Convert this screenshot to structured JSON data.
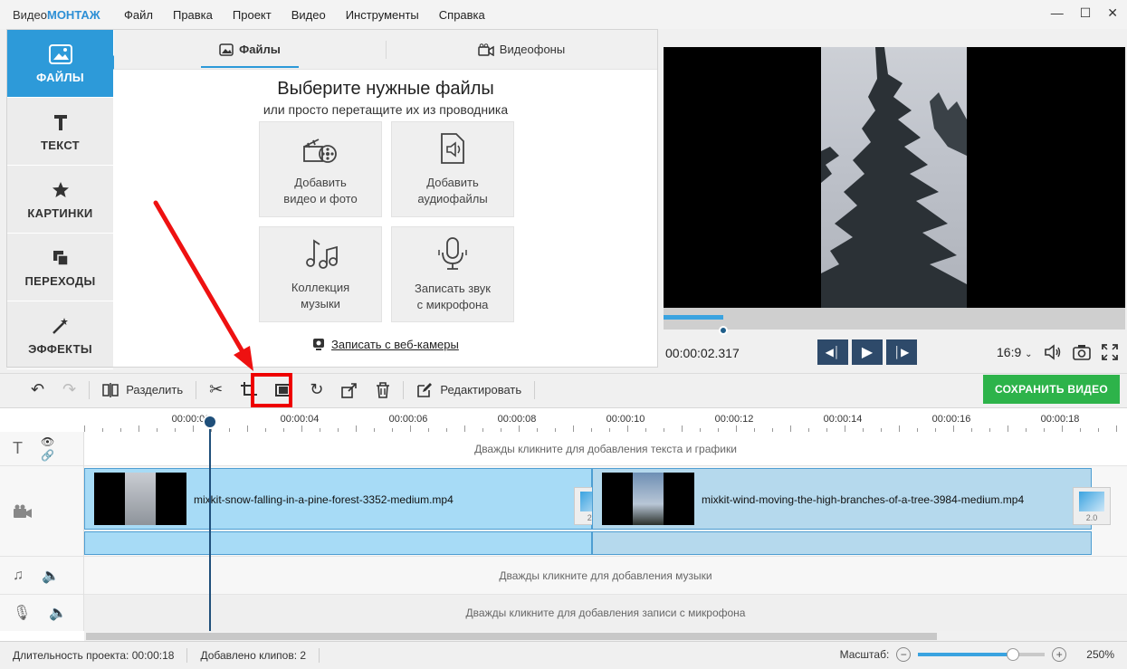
{
  "app": {
    "logo_prefix": "Видео",
    "logo_brand": "МОНТАЖ",
    "menu": [
      "Файл",
      "Правка",
      "Проект",
      "Видео",
      "Инструменты",
      "Справка"
    ]
  },
  "sidenav": [
    {
      "label": "ФАЙЛЫ",
      "icon": "image-icon",
      "active": true
    },
    {
      "label": "ТЕКСТ",
      "icon": "text-t-icon"
    },
    {
      "label": "КАРТИНКИ",
      "icon": "star-icon"
    },
    {
      "label": "ПЕРЕХОДЫ",
      "icon": "transitions-icon"
    },
    {
      "label": "ЭФФЕКТЫ",
      "icon": "magic-wand-icon"
    }
  ],
  "files_panel": {
    "tabs": [
      {
        "label": "Файлы",
        "icon": "image-icon",
        "active": true
      },
      {
        "label": "Видеофоны",
        "icon": "camera-icon"
      }
    ],
    "heading": "Выберите нужные файлы",
    "subheading": "или просто перетащите их из проводника",
    "tiles": [
      {
        "line1": "Добавить",
        "line2": "видео и фото",
        "icon": "film-reel-icon"
      },
      {
        "line1": "Добавить",
        "line2": "аудиофайлы",
        "icon": "audio-file-icon"
      },
      {
        "line1": "Коллекция",
        "line2": "музыки",
        "icon": "music-notes-icon"
      },
      {
        "line1": "Записать звук",
        "line2": "с микрофона",
        "icon": "microphone-icon"
      }
    ],
    "webcam_label": "Записать с веб-камеры"
  },
  "preview": {
    "timecode": "00:00:02.317",
    "progress": 0.13,
    "aspect": "16:9"
  },
  "toolbar": {
    "split_label": "Разделить",
    "edit_label": "Редактировать",
    "save_label": "СОХРАНИТЬ ВИДЕО"
  },
  "timeline": {
    "ruler_labels": [
      "00:00:02",
      "00:00:04",
      "00:00:06",
      "00:00:08",
      "00:00:10",
      "00:00:12",
      "00:00:14",
      "00:00:16",
      "00:00:18"
    ],
    "text_hint": "Дважды кликните для добавления текста и графики",
    "music_hint": "Дважды кликните для добавления музыки",
    "mic_hint": "Дважды кликните для добавления записи с микрофона",
    "clips": [
      {
        "name": "mixkit-snow-falling-in-a-pine-forest-3352-medium.mp4",
        "transition": "2.0",
        "selected": true
      },
      {
        "name": "mixkit-wind-moving-the-high-branches-of-a-tree-3984-medium.mp4",
        "transition": "2.0",
        "selected": false
      }
    ]
  },
  "status": {
    "duration_label": "Длительность проекта:",
    "duration_value": "00:00:18",
    "clips_label": "Добавлено клипов:",
    "clips_value": "2",
    "zoom_label": "Масштаб:",
    "zoom_value": "250%"
  },
  "colors": {
    "accent": "#2d9ad9",
    "save": "#2db34a",
    "highlight": "#ee0000"
  }
}
